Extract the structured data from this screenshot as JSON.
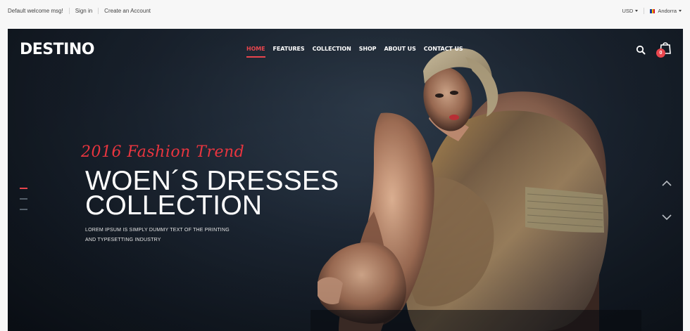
{
  "topbar": {
    "welcome": "Default welcome msg!",
    "sign_in": "Sign in",
    "create_account": "Create an Account",
    "currency": "USD",
    "country": "Andorra"
  },
  "header": {
    "logo": "DESTINO",
    "nav": [
      "HOME",
      "FEATURES",
      "COLLECTION",
      "SHOP",
      "ABOUT US",
      "CONTACT US"
    ],
    "active_nav": "HOME",
    "cart_count": "0"
  },
  "hero": {
    "tagline": "2016 Fashion Trend",
    "headline_line1": "WOEN´S DRESSES",
    "headline_line2": "COLLECTION",
    "desc_line1": "LOREM IPSUM IS SIMPLY DUMMY TEXT OF THE PRINTING",
    "desc_line2": "AND TYPESETTING INDUSTRY",
    "slides_total": 3,
    "active_slide": 1
  },
  "colors": {
    "accent": "#e8454d",
    "hero_bg": "#1c2633",
    "topbar_bg": "#f7f7f7"
  },
  "icons": [
    "search-icon",
    "shopping-bag-icon",
    "chevron-up-icon",
    "chevron-down-icon",
    "flag-icon"
  ]
}
